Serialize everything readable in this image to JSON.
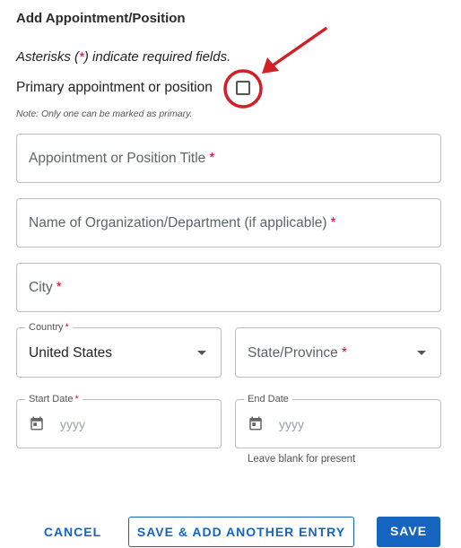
{
  "form": {
    "title": "Add Appointment/Position",
    "required_note": {
      "prefix": "Asterisks (",
      "asterisk": "*",
      "suffix": ") indicate required fields."
    },
    "primary_label": "Primary appointment or position",
    "primary_checked": false,
    "primary_hint": "Note: Only one can be marked as primary.",
    "required_marker": "*",
    "title_field": {
      "placeholder": "Appointment or Position Title"
    },
    "org_field": {
      "placeholder": "Name of Organization/Department (if applicable)"
    },
    "city_field": {
      "placeholder": "City"
    },
    "country_field": {
      "label": "Country",
      "value": "United States"
    },
    "state_field": {
      "placeholder": "State/Province"
    },
    "start_date": {
      "label": "Start Date",
      "placeholder": "yyyy"
    },
    "end_date": {
      "label": "End Date",
      "placeholder": "yyyy",
      "helper": "Leave blank for present"
    }
  },
  "actions": {
    "cancel": "CANCEL",
    "save_add": "SAVE & ADD ANOTHER ENTRY",
    "save": "SAVE"
  },
  "colors": {
    "accent": "#1565c0",
    "required": "#c8102e",
    "annotation": "#d32027"
  },
  "icons": [
    "calendar-icon",
    "chevron-down-icon"
  ]
}
